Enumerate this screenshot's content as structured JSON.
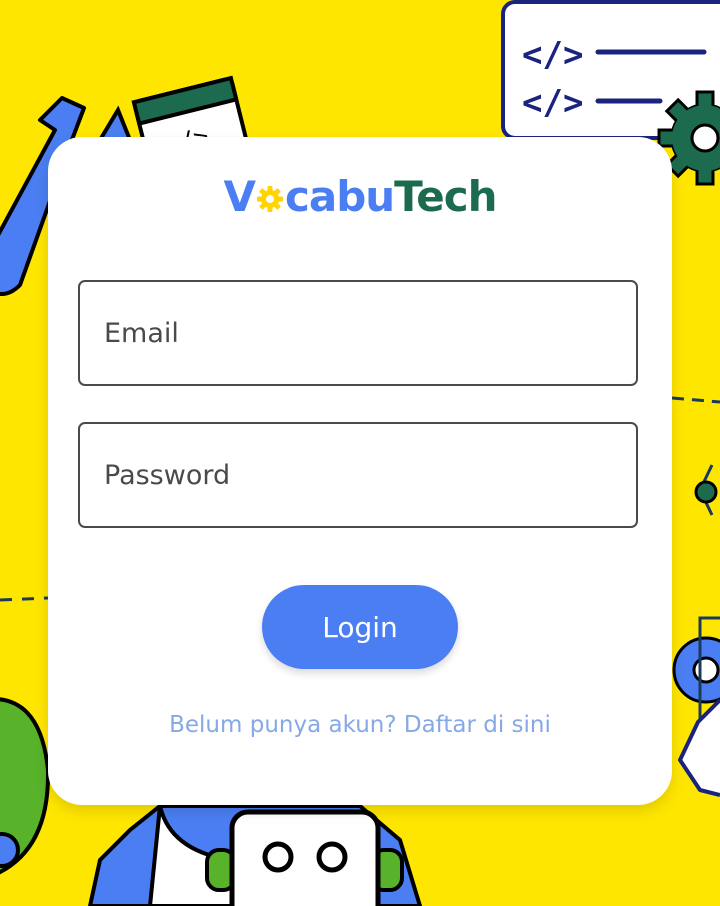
{
  "logo": {
    "text_1": "V",
    "text_2": "cabu",
    "text_3": "Tech",
    "colors": {
      "blue": "#4a7ef2",
      "green": "#1d6b4e",
      "gear": "#ffd400"
    }
  },
  "form": {
    "email_placeholder": "Email",
    "password_placeholder": "Password",
    "login_label": "Login",
    "register_text": "Belum punya akun? Daftar di sini"
  },
  "theme": {
    "background": "#ffe600",
    "card": "#ffffff",
    "button": "#4a7ef2",
    "link": "#86a8e6"
  },
  "background_icons": [
    "code-window-icon",
    "gear-icon",
    "wrench-icon",
    "robot-icon",
    "leaf-icon",
    "dashed-line"
  ]
}
